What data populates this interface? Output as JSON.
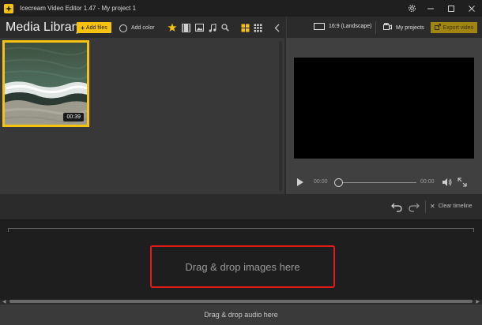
{
  "window": {
    "title": "Icecream Video Editor 1.47 - My project 1",
    "controls": [
      "settings",
      "minimize",
      "maximize",
      "close"
    ]
  },
  "toolbar": {
    "media_title": "Media Library",
    "add_files_label": "Add files",
    "add_color_label": "Add color",
    "filters": [
      "favorites",
      "video",
      "image",
      "audio",
      "search"
    ],
    "views": [
      "grid-large",
      "grid-small"
    ]
  },
  "toolbar_right": {
    "aspect_label": "16:9 (Landscape)",
    "my_projects_label": "My projects",
    "export_label": "Export video"
  },
  "library": {
    "items": [
      {
        "type": "video",
        "duration": "00:39",
        "selected": true
      }
    ]
  },
  "player": {
    "current_time": "00:00",
    "total_time": "00:00",
    "progress": 0
  },
  "timeline": {
    "clear_label": "Clear timeline",
    "images_placeholder": "Drag & drop images here",
    "audio_placeholder": "Drag & drop audio here"
  },
  "colors": {
    "accent": "#f5c211",
    "highlight_border": "#e01b1b",
    "background": "#2b2b2b"
  }
}
